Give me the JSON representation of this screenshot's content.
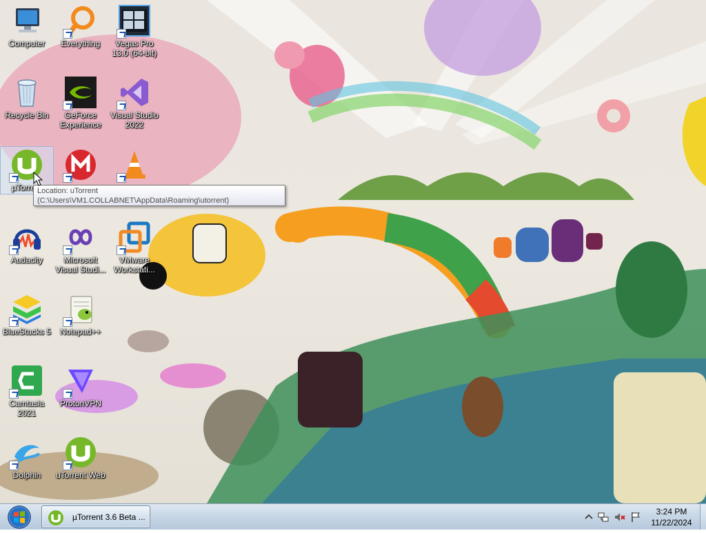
{
  "desktop": {
    "icons": [
      {
        "label": "Computer",
        "icon": "computer-icon"
      },
      {
        "label": "Everything",
        "icon": "everything-icon"
      },
      {
        "label": "Vegas Pro 13.0 (64-bit)",
        "icon": "vegas-pro-icon"
      },
      {
        "label": "Recycle Bin",
        "icon": "recycle-bin-icon"
      },
      {
        "label": "GeForce Experience",
        "icon": "geforce-icon"
      },
      {
        "label": "Visual Studio 2022",
        "icon": "visual-studio-icon"
      },
      {
        "label": "µTorrent",
        "icon": "utorrent-icon"
      },
      {
        "label": "",
        "icon": "mega-icon"
      },
      {
        "label": "",
        "icon": "vlc-icon"
      },
      {
        "label": "Audacity",
        "icon": "audacity-icon"
      },
      {
        "label": "Microsoft Visual Studi...",
        "icon": "vs-installer-icon"
      },
      {
        "label": "VMware Workstati...",
        "icon": "vmware-icon"
      },
      {
        "label": "BlueStacks 5",
        "icon": "bluestacks-icon"
      },
      {
        "label": "Notepad++",
        "icon": "notepadpp-icon"
      },
      {
        "label": "Camtasia 2021",
        "icon": "camtasia-icon"
      },
      {
        "label": "ProtonVPN",
        "icon": "protonvpn-icon"
      },
      {
        "label": "Dolphin",
        "icon": "dolphin-icon"
      },
      {
        "label": "uTorrent Web",
        "icon": "utorrent-web-icon"
      }
    ]
  },
  "tooltip": {
    "text": "Location: uTorrent (C:\\Users\\VM1.COLLABNET\\AppData\\Roaming\\utorrent)"
  },
  "taskbar": {
    "start_icon": "windows-start-icon",
    "task_button_label": "µTorrent 3.6 Beta ...",
    "tray_icons": [
      "show-hidden-icons-chevron",
      "network-icon",
      "volume-muted-icon",
      "action-center-flag-icon"
    ],
    "clock_time": "3:24 PM",
    "clock_date": "11/22/2024"
  },
  "colors": {
    "taskbar_top": "#dfe8f1",
    "taskbar_bottom": "#b6c9dc",
    "utorrent_green": "#77b82a",
    "label_text": "#ffffff"
  }
}
